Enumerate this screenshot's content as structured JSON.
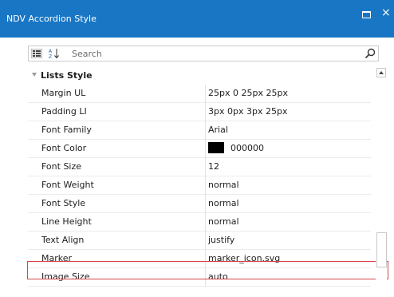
{
  "window": {
    "title": "NDV Accordion Style",
    "close_glyph": "×"
  },
  "toolbar": {
    "search_placeholder": "Search",
    "categorized_icon": "categorized-icon",
    "alphabetical_icon": "sort-alphabetical-icon",
    "search_icon": "search-icon"
  },
  "section": {
    "label": "Lists Style"
  },
  "properties": [
    {
      "name": "Margin UL",
      "value": "25px 0 25px 25px"
    },
    {
      "name": "Padding LI",
      "value": "3px 0px 3px 25px"
    },
    {
      "name": "Font Family",
      "value": "Arial"
    },
    {
      "name": "Font Color",
      "value": "000000",
      "swatch": "#000000"
    },
    {
      "name": "Font Size",
      "value": "12"
    },
    {
      "name": "Font Weight",
      "value": "normal"
    },
    {
      "name": "Font Style",
      "value": "normal"
    },
    {
      "name": "Line Height",
      "value": "normal"
    },
    {
      "name": "Text Align",
      "value": "justify"
    },
    {
      "name": "Marker",
      "value": "marker_icon.svg",
      "button": "..."
    },
    {
      "name": "Image Size",
      "value": "auto"
    }
  ],
  "colors": {
    "titlebar": "#1976c5",
    "selection_border": "#d9444a"
  }
}
